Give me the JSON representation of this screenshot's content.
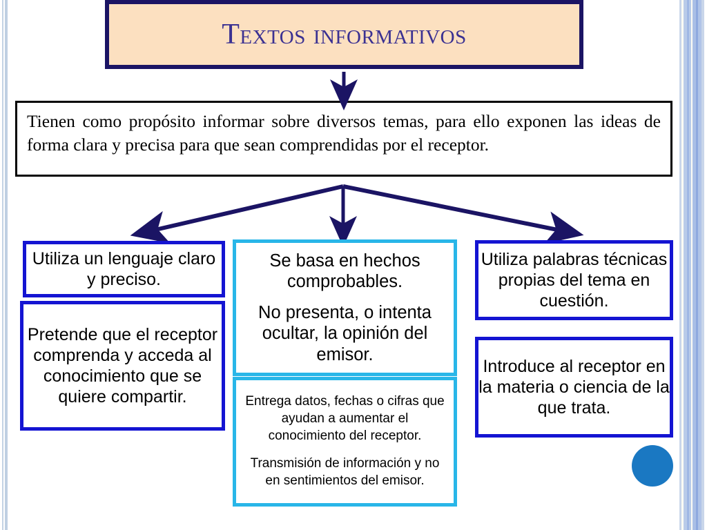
{
  "colors": {
    "title_bg": "#fce0c0",
    "title_border": "#1b1464",
    "title_text": "#3b3192",
    "arrow": "#1b1464",
    "blue_border": "#1414d2",
    "cyan_border": "#29b6e8",
    "dot": "#1a78c2",
    "desc_border": "#000000",
    "body_text": "#000000"
  },
  "title": {
    "text": "Textos informativos"
  },
  "description": {
    "text": "Tienen como propósito informar sobre diversos temas, para ello exponen las ideas de forma clara y precisa para que sean comprendidas por el receptor."
  },
  "columns": {
    "left": {
      "boxes": [
        {
          "lines": [
            "Utiliza un lenguaje claro y preciso."
          ]
        },
        {
          "lines": [
            "Pretende que el receptor comprenda y acceda al conocimiento que se quiere compartir."
          ]
        }
      ]
    },
    "middle": {
      "boxes": [
        {
          "lines": [
            "Se basa en hechos comprobables.",
            "No presenta, o intenta ocultar, la opinión del emisor."
          ]
        },
        {
          "lines": [
            "Entrega datos, fechas o cifras que ayudan a aumentar el conocimiento del receptor.",
            "Transmisión de información y no en sentimientos del emisor."
          ]
        }
      ]
    },
    "right": {
      "boxes": [
        {
          "lines": [
            "Utiliza palabras técnicas propias del tema en cuestión."
          ]
        },
        {
          "lines": [
            "Introduce al receptor en la materia o ciencia de la que trata."
          ]
        }
      ]
    }
  },
  "connectors": {
    "title_to_description": "down-arrow",
    "description_to_left": "diagonal-left-arrow",
    "description_to_middle": "down-arrow",
    "description_to_right": "diagonal-right-arrow"
  },
  "decorations": {
    "left_edge_stripe": "vertical-stripe-band",
    "right_edge_stripe": "vertical-stripe-band",
    "circle": "blue-dot"
  }
}
